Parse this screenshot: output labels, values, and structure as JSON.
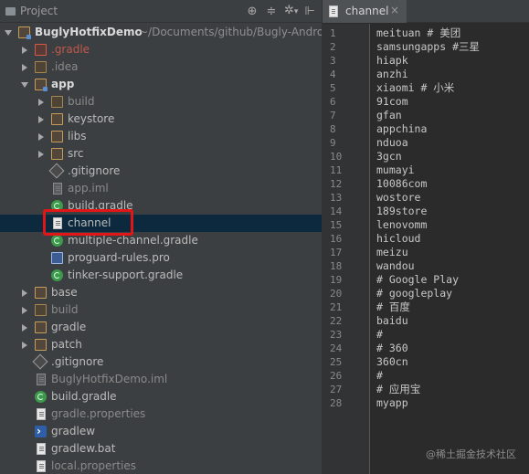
{
  "project_panel": {
    "title": "Project",
    "tools": {
      "target": "⊕",
      "collapse": "≑",
      "gear": "✲",
      "gear_arrow": "▾",
      "hide": "⊩"
    },
    "tree": [
      {
        "label": "BuglyHotfixDemo",
        "suffix": "~/Documents/github/Bugly-Android",
        "depth": 0,
        "arrow": "down",
        "icon": "module-folder"
      },
      {
        "label": ".gradle",
        "depth": 1,
        "arrow": "right",
        "icon": "folder-red",
        "style": "red"
      },
      {
        "label": ".idea",
        "depth": 1,
        "arrow": "right",
        "icon": "folder-plain",
        "style": "dim"
      },
      {
        "label": "app",
        "depth": 1,
        "arrow": "down",
        "icon": "module-folder",
        "style": "bold"
      },
      {
        "label": "build",
        "depth": 2,
        "arrow": "right",
        "icon": "folder-plain",
        "style": "dim"
      },
      {
        "label": "keystore",
        "depth": 2,
        "arrow": "right",
        "icon": "folder"
      },
      {
        "label": "libs",
        "depth": 2,
        "arrow": "right",
        "icon": "folder"
      },
      {
        "label": "src",
        "depth": 2,
        "arrow": "right",
        "icon": "folder"
      },
      {
        "label": ".gitignore",
        "depth": 2,
        "icon": "git"
      },
      {
        "label": "app.iml",
        "depth": 2,
        "icon": "file-dark",
        "style": "dim"
      },
      {
        "label": "build.gradle",
        "depth": 2,
        "icon": "gradle"
      },
      {
        "label": "channel",
        "depth": 2,
        "icon": "file",
        "selected": true
      },
      {
        "label": "multiple-channel.gradle",
        "depth": 2,
        "icon": "gradle"
      },
      {
        "label": "proguard-rules.pro",
        "depth": 2,
        "icon": "pro"
      },
      {
        "label": "tinker-support.gradle",
        "depth": 2,
        "icon": "gradle"
      },
      {
        "label": "base",
        "depth": 1,
        "arrow": "right",
        "icon": "folder"
      },
      {
        "label": "build",
        "depth": 1,
        "arrow": "right",
        "icon": "folder-plain",
        "style": "dim"
      },
      {
        "label": "gradle",
        "depth": 1,
        "arrow": "right",
        "icon": "folder"
      },
      {
        "label": "patch",
        "depth": 1,
        "arrow": "right",
        "icon": "folder"
      },
      {
        "label": ".gitignore",
        "depth": 1,
        "icon": "git"
      },
      {
        "label": "BuglyHotfixDemo.iml",
        "depth": 1,
        "icon": "file-dark",
        "style": "dim"
      },
      {
        "label": "build.gradle",
        "depth": 1,
        "icon": "gradle"
      },
      {
        "label": "gradle.properties",
        "depth": 1,
        "icon": "file",
        "style": "dim"
      },
      {
        "label": "gradlew",
        "depth": 1,
        "icon": "shell"
      },
      {
        "label": "gradlew.bat",
        "depth": 1,
        "icon": "file"
      },
      {
        "label": "local.properties",
        "depth": 1,
        "icon": "file",
        "style": "dim"
      }
    ]
  },
  "editor": {
    "tab_label": "channel",
    "tab_close": "×",
    "lines": [
      "meituan # 美团",
      "samsungapps #三星",
      "hiapk",
      "anzhi",
      "xiaomi # 小米",
      "91com",
      "gfan",
      "appchina",
      "nduoa",
      "3gcn",
      "mumayi",
      "10086com",
      "wostore",
      "189store",
      "lenovomm",
      "hicloud",
      "meizu",
      "wandou",
      "# Google Play",
      "# googleplay",
      "# 百度",
      "baidu",
      "#",
      "# 360",
      "360cn",
      "#",
      "# 应用宝",
      "myapp"
    ]
  },
  "watermark": "@稀土掘金技术社区",
  "colors": {
    "panel_bg": "#3c3f41",
    "editor_bg": "#2b2b2b",
    "selection": "#0d293e",
    "highlight": "#e21616"
  }
}
